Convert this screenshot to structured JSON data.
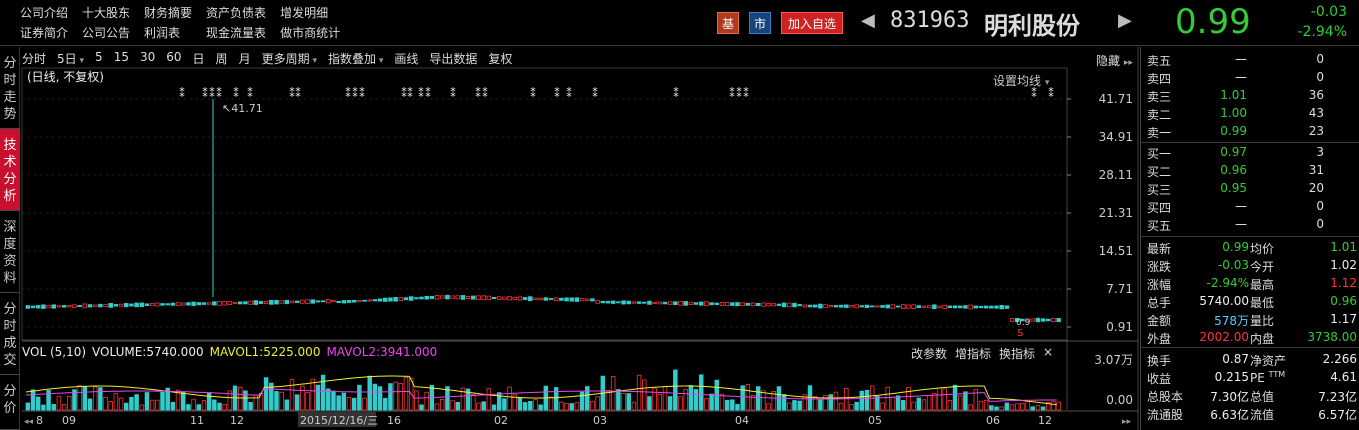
{
  "nav": {
    "row1": [
      "公司介绍",
      "十大股东",
      "财务摘要",
      "资产负债表",
      "增发明细"
    ],
    "row2": [
      "证券简介",
      "公司公告",
      "利润表",
      "现金流量表",
      "做市商统计"
    ]
  },
  "header": {
    "badge_ji": "基",
    "badge_shi": "市",
    "add_watch": "加入自选",
    "prev": "◀",
    "next": "▶",
    "code": "831963",
    "name": "明利股份",
    "price": "0.99",
    "change": "-0.03",
    "change_pct": "-2.94%"
  },
  "left_tabs": [
    "分时走势",
    "技术分析",
    "深度资料",
    "分时成交",
    "分价"
  ],
  "toolbar": [
    "分时",
    "5日",
    "5",
    "15",
    "30",
    "60",
    "日",
    "周",
    "月",
    "更多周期",
    "指数叠加",
    "画线",
    "导出数据",
    "复权"
  ],
  "sublabel": "(日线, 不复权)",
  "hide_label": "隐藏",
  "set_ma": "设置均线",
  "price_axis": [
    "41.71",
    "34.91",
    "28.11",
    "21.31",
    "14.51",
    "7.71",
    "0.91"
  ],
  "peak_label": "41.71",
  "vol": {
    "name": "VOL (5,10)",
    "volume": "VOLUME:5740.000",
    "ma1": "MAVOL1:5225.000",
    "ma2": "MAVOL2:3941.000",
    "tools": [
      "改参数",
      "增指标",
      "换指标",
      "×"
    ],
    "axis_top": "3.07万",
    "axis_bottom": "0.00"
  },
  "date_axis": [
    "8",
    "09",
    "11",
    "12",
    "2015/12/16/三",
    "16",
    "02",
    "03",
    "04",
    "05",
    "06",
    "12"
  ],
  "orderbook": {
    "sells": [
      {
        "label": "卖五",
        "price": "—",
        "vol": "0"
      },
      {
        "label": "卖四",
        "price": "—",
        "vol": "0"
      },
      {
        "label": "卖三",
        "price": "1.01",
        "vol": "36"
      },
      {
        "label": "卖二",
        "price": "1.00",
        "vol": "43"
      },
      {
        "label": "卖一",
        "price": "0.99",
        "vol": "23"
      }
    ],
    "buys": [
      {
        "label": "买一",
        "price": "0.97",
        "vol": "3"
      },
      {
        "label": "买二",
        "price": "0.96",
        "vol": "31"
      },
      {
        "label": "买三",
        "price": "0.95",
        "vol": "20"
      },
      {
        "label": "买四",
        "price": "—",
        "vol": "0"
      },
      {
        "label": "买五",
        "price": "—",
        "vol": "0"
      }
    ]
  },
  "stats": [
    {
      "l1": "最新",
      "v1": "0.99",
      "c1": "green",
      "l2": "均价",
      "v2": "1.01",
      "c2": "green"
    },
    {
      "l1": "涨跌",
      "v1": "-0.03",
      "c1": "green",
      "l2": "今开",
      "v2": "1.02",
      "c2": "white"
    },
    {
      "l1": "涨幅",
      "v1": "-2.94%",
      "c1": "green",
      "l2": "最高",
      "v2": "1.12",
      "c2": "red"
    },
    {
      "l1": "总手",
      "v1": "5740.00",
      "c1": "white",
      "l2": "最低",
      "v2": "0.96",
      "c2": "green"
    },
    {
      "l1": "金额",
      "v1": "578万",
      "c1": "cyan",
      "l2": "量比",
      "v2": "1.17",
      "c2": "white"
    },
    {
      "l1": "外盘",
      "v1": "2002.00",
      "c1": "red",
      "l2": "内盘",
      "v2": "3738.00",
      "c2": "green"
    }
  ],
  "stats2": [
    {
      "l1": "换手",
      "v1": "0.87",
      "c1": "white",
      "l2": "净资产",
      "v2": "2.266",
      "c2": "white"
    },
    {
      "l1": "收益",
      "v1": "0.215",
      "c1": "white",
      "l2": "PE TTM",
      "v2": "4.61",
      "c2": "white"
    },
    {
      "l1": "总股本",
      "v1": "7.30亿",
      "c1": "white",
      "l2": "总值",
      "v2": "7.23亿",
      "c2": "white"
    },
    {
      "l1": "流通股",
      "v1": "6.63亿",
      "c1": "white",
      "l2": "流值",
      "v2": "6.57亿",
      "c2": "white"
    }
  ],
  "colors": {
    "up": "#ff3333",
    "down": "#33cccc",
    "ma1": "#eeee33",
    "ma2": "#ee44ee"
  }
}
